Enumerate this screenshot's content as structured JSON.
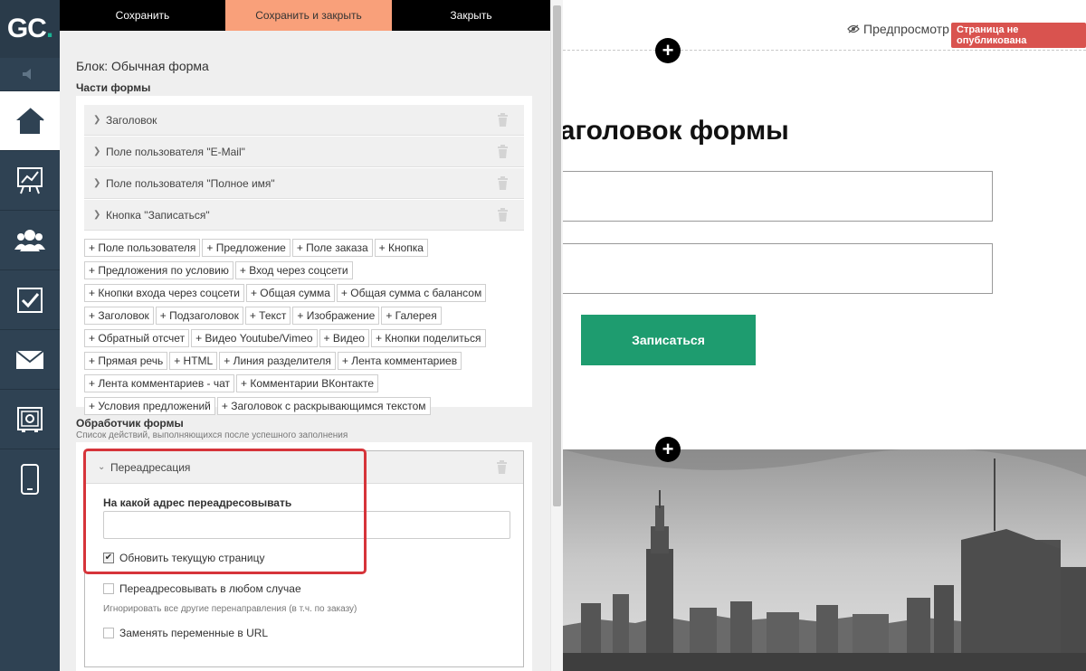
{
  "nav": {
    "logo_text": "GC",
    "logo_dot": ".",
    "items": [
      {
        "icon": "speaker-icon"
      },
      {
        "icon": "home-icon",
        "active": true
      },
      {
        "icon": "chart-board-icon"
      },
      {
        "icon": "users-icon"
      },
      {
        "icon": "checkbox-icon"
      },
      {
        "icon": "envelope-icon"
      },
      {
        "icon": "safe-icon"
      },
      {
        "icon": "mobile-icon"
      }
    ]
  },
  "toolbar": {
    "save": "Сохранить",
    "save_close": "Сохранить и закрыть",
    "close": "Закрыть"
  },
  "block_title": "Блок: Обычная форма",
  "parts": {
    "title": "Части формы",
    "items": [
      {
        "label": "Заголовок"
      },
      {
        "label": "Поле пользователя \"E-Mail\""
      },
      {
        "label": "Поле пользователя \"Полное имя\""
      },
      {
        "label": "Кнопка \"Записаться\""
      }
    ],
    "add_buttons": [
      "+ Поле пользователя",
      "+ Предложение",
      "+ Поле заказа",
      "+ Кнопка",
      "+ Предложения по условию",
      "+ Вход через соцсети",
      "+ Кнопки входа через соцсети",
      "+ Общая сумма",
      "+ Общая сумма с балансом",
      "+ Заголовок",
      "+ Подзаголовок",
      "+ Текст",
      "+ Изображение",
      "+ Галерея",
      "+ Обратный отсчет",
      "+ Видео Youtube/Vimeo",
      "+ Видео",
      "+ Кнопки поделиться",
      "+ Прямая речь",
      "+ HTML",
      "+ Линия разделителя",
      "+ Лента комментариев",
      "+ Лента комментариев - чат",
      "+ Комментарии ВКонтакте",
      "+ Условия предложений",
      "+ Заголовок с раскрывающимся текстом"
    ]
  },
  "handler": {
    "title": "Обработчик формы",
    "subtitle": "Список действий, выполняющихся после успешного заполнения",
    "action": {
      "label": "Переадресация",
      "field_label": "На какой адрес переадресовывать",
      "field_value": "",
      "checkbox_refresh": "Обновить текущую страницу",
      "checkbox_refresh_checked": true,
      "checkbox_always": "Переадресовывать в любом случае",
      "checkbox_always_checked": false,
      "always_hint": "Игнорировать все другие перенаправления (в т.ч. по заказу)",
      "checkbox_vars": "Заменять переменные в URL",
      "checkbox_vars_checked": false
    }
  },
  "preview": {
    "preview_label": "Предпросмотр",
    "status_badge": "Страница не опубликована",
    "form_title": "Заголовок формы",
    "submit_label": "Записаться",
    "plus": "+"
  },
  "colors": {
    "nav_bg": "#2f4253",
    "accent_orange": "#f9a07a",
    "submit_green": "#1e9c6f",
    "badge_red": "#d9534f",
    "highlight_red": "#d6343a"
  }
}
